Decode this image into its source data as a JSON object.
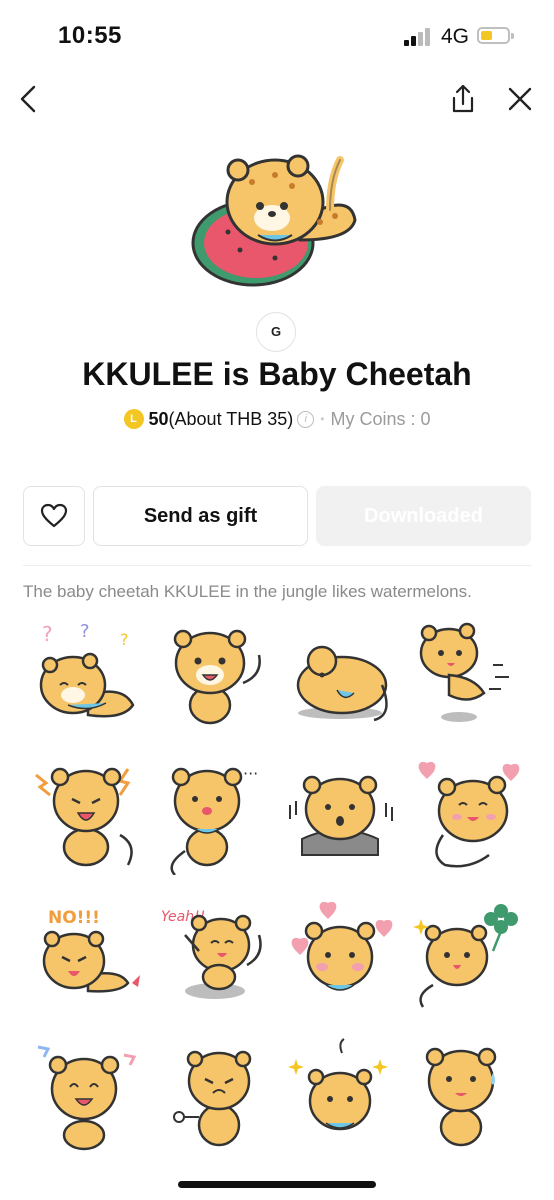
{
  "status": {
    "time": "10:55",
    "network": "4G",
    "battery_color": "#f3c623"
  },
  "nav": {
    "back_icon": "chevron-left-icon",
    "share_icon": "share-icon",
    "close_icon": "close-icon"
  },
  "product": {
    "badge": "G",
    "title": "KKULEE is Baby Cheetah",
    "coin_symbol": "L",
    "price": "50",
    "price_note": "(About THB 35)",
    "info_symbol": "i",
    "my_coins": "My Coins : 0",
    "description": "The baby cheetah KKULEE in the jungle likes watermelons."
  },
  "actions": {
    "favorite_icon": "heart-icon",
    "gift_label": "Send as gift",
    "download_label": "Downloaded"
  },
  "stickers": {
    "row1": [
      "confused-cheetah",
      "smiling-cheetah",
      "curled-cheetah",
      "running-cheetah"
    ],
    "row2": [
      "angry-cheetah",
      "thinking-cheetah",
      "shocked-cheetah",
      "love-cheetah"
    ],
    "row3": [
      "no-cheetah",
      "yeah-cheetah",
      "blushing-cheetah",
      "clover-cheetah"
    ],
    "row4": [
      "laughing-cheetah",
      "fist-cheetah",
      "sparkle-cheetah",
      "sweating-cheetah"
    ],
    "captions": {
      "no": "NO!!!",
      "yeah": "Yeah!!"
    }
  },
  "colors": {
    "accent_coin": "#f3c623",
    "cheetah_fur": "#f6c56a",
    "watermelon": "#e8576b",
    "rind": "#3f9a6e"
  }
}
